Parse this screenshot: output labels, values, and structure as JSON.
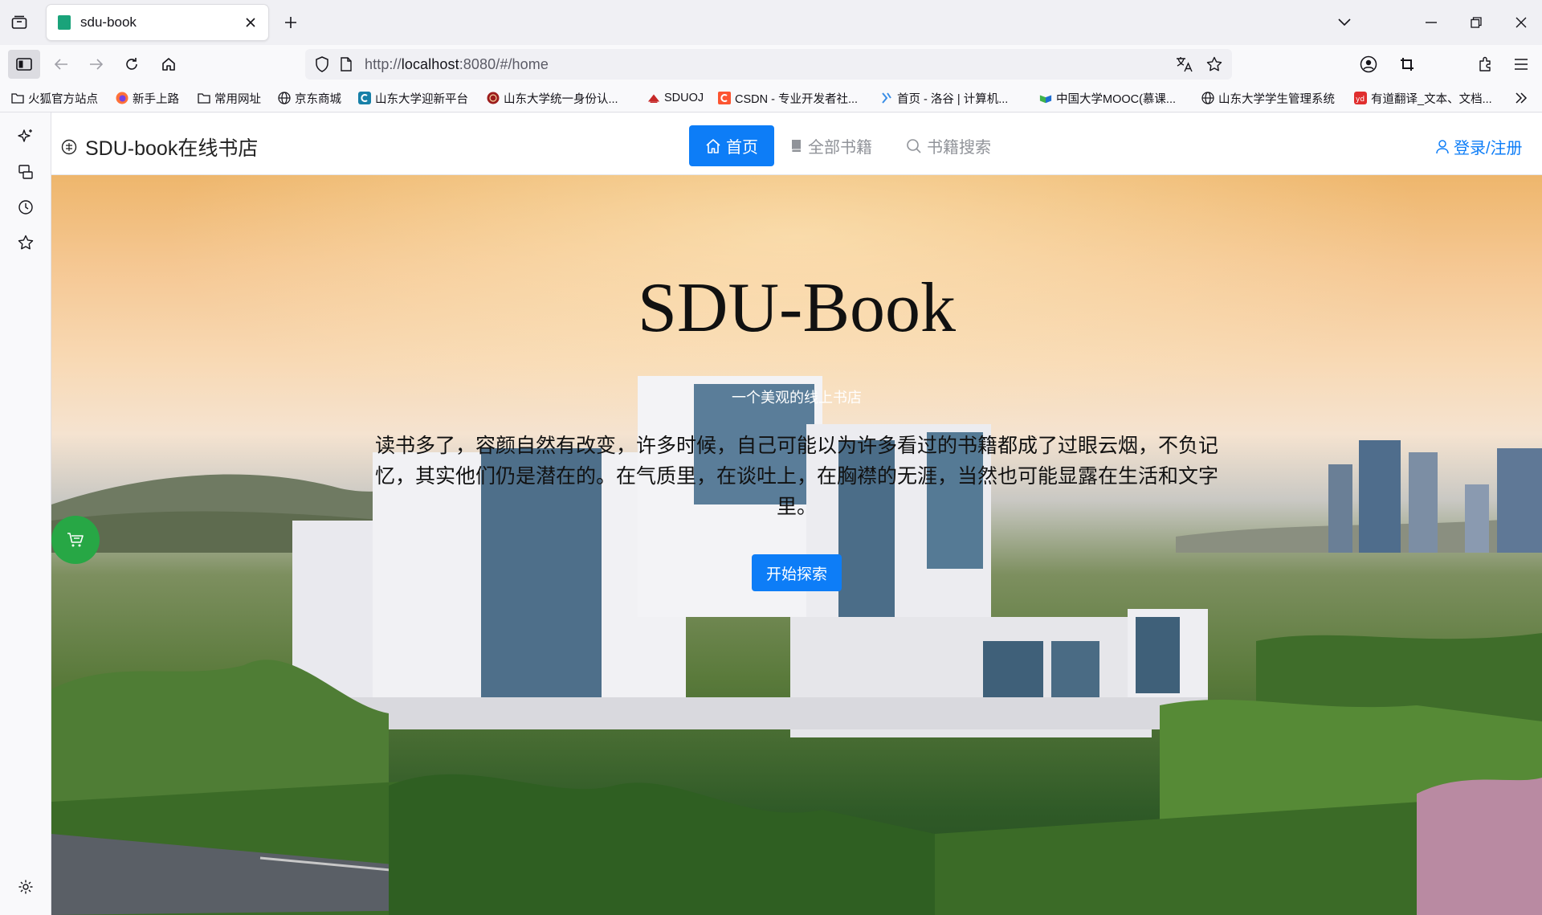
{
  "browser": {
    "tab_title": "sdu-book",
    "url_prefix": "http://",
    "url_host": "localhost",
    "url_rest": ":8080/#/home"
  },
  "bookmarks": [
    {
      "label": "火狐官方站点",
      "icon": "folder-icon"
    },
    {
      "label": "新手上路",
      "icon": "firefox-icon"
    },
    {
      "label": "常用网址",
      "icon": "folder-icon"
    },
    {
      "label": "京东商城",
      "icon": "globe-icon"
    },
    {
      "label": "山东大学迎新平台",
      "icon": "c-logo-icon"
    },
    {
      "label": "山东大学统一身份认...",
      "icon": "sdu-seal-icon"
    },
    {
      "label": "SDUOJ",
      "icon": "sduoj-icon"
    },
    {
      "label": "CSDN - 专业开发者社...",
      "icon": "csdn-icon"
    },
    {
      "label": "首页 - 洛谷 | 计算机...",
      "icon": "luogu-icon"
    },
    {
      "label": "中国大学MOOC(慕课...",
      "icon": "mooc-icon"
    },
    {
      "label": "山东大学学生管理系统",
      "icon": "globe-icon"
    },
    {
      "label": "有道翻译_文本、文档...",
      "icon": "youdao-icon"
    }
  ],
  "site": {
    "brand": "SDU-book在线书店",
    "nav": {
      "home": "首页",
      "books": "全部书籍",
      "search": "书籍搜索"
    },
    "login": "登录/注册"
  },
  "hero": {
    "title": "SDU-Book",
    "subtitle": "一个美观的线上书店",
    "quote": "读书多了，容颜自然有改变，许多时候，自己可能以为许多看过的书籍都成了过眼云烟，不负记忆，其实他们仍是潜在的。在气质里，在谈吐上，在胸襟的无涯，当然也可能显露在生活和文字里。",
    "button": "开始探索"
  },
  "colors": {
    "primary": "#0d7df7",
    "cart": "#27a745"
  }
}
